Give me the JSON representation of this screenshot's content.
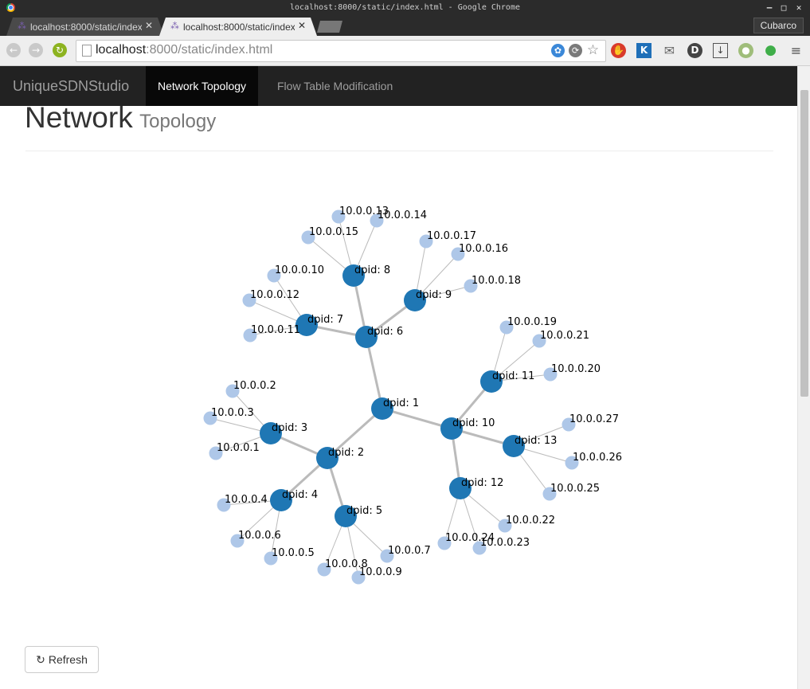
{
  "window": {
    "title": "localhost:8000/static/index.html - Google Chrome"
  },
  "tabs": [
    {
      "label": "localhost:8000/static/index.html",
      "active": false
    },
    {
      "label": "localhost:8000/static/index.html",
      "active": true
    }
  ],
  "profile_name": "Cubarco",
  "address": {
    "host": "localhost",
    "rest": ":8000/static/index.html"
  },
  "app": {
    "brand": "UniqueSDNStudio",
    "nav": [
      {
        "label": "Network Topology",
        "active": true
      },
      {
        "label": "Flow Table Modification",
        "active": false
      }
    ]
  },
  "page": {
    "title": "Network",
    "subtitle": "Topology"
  },
  "topology": {
    "switch_color": "#1f77b4",
    "host_color": "#aec7e8",
    "switches": [
      {
        "id": "s1",
        "label": "dpid: 1"
      },
      {
        "id": "s2",
        "label": "dpid: 2"
      },
      {
        "id": "s3",
        "label": "dpid: 3"
      },
      {
        "id": "s4",
        "label": "dpid: 4"
      },
      {
        "id": "s5",
        "label": "dpid: 5"
      },
      {
        "id": "s6",
        "label": "dpid: 6"
      },
      {
        "id": "s7",
        "label": "dpid: 7"
      },
      {
        "id": "s8",
        "label": "dpid: 8"
      },
      {
        "id": "s9",
        "label": "dpid: 9"
      },
      {
        "id": "s10",
        "label": "dpid: 10"
      },
      {
        "id": "s11",
        "label": "dpid: 11"
      },
      {
        "id": "s12",
        "label": "dpid: 12"
      },
      {
        "id": "s13",
        "label": "dpid: 13"
      }
    ],
    "hosts": [
      {
        "id": "h1",
        "label": "10.0.0.1",
        "switch": "s3"
      },
      {
        "id": "h2",
        "label": "10.0.0.2",
        "switch": "s3"
      },
      {
        "id": "h3",
        "label": "10.0.0.3",
        "switch": "s3"
      },
      {
        "id": "h4",
        "label": "10.0.0.4",
        "switch": "s4"
      },
      {
        "id": "h5",
        "label": "10.0.0.5",
        "switch": "s4"
      },
      {
        "id": "h6",
        "label": "10.0.0.6",
        "switch": "s4"
      },
      {
        "id": "h7",
        "label": "10.0.0.7",
        "switch": "s5"
      },
      {
        "id": "h8",
        "label": "10.0.0.8",
        "switch": "s5"
      },
      {
        "id": "h9",
        "label": "10.0.0.9",
        "switch": "s5"
      },
      {
        "id": "h10",
        "label": "10.0.0.10",
        "switch": "s7"
      },
      {
        "id": "h11",
        "label": "10.0.0.11",
        "switch": "s7"
      },
      {
        "id": "h12",
        "label": "10.0.0.12",
        "switch": "s7"
      },
      {
        "id": "h13",
        "label": "10.0.0.13",
        "switch": "s8"
      },
      {
        "id": "h14",
        "label": "10.0.0.14",
        "switch": "s8"
      },
      {
        "id": "h15",
        "label": "10.0.0.15",
        "switch": "s8"
      },
      {
        "id": "h16",
        "label": "10.0.0.16",
        "switch": "s9"
      },
      {
        "id": "h17",
        "label": "10.0.0.17",
        "switch": "s9"
      },
      {
        "id": "h18",
        "label": "10.0.0.18",
        "switch": "s9"
      },
      {
        "id": "h19",
        "label": "10.0.0.19",
        "switch": "s11"
      },
      {
        "id": "h20",
        "label": "10.0.0.20",
        "switch": "s11"
      },
      {
        "id": "h21",
        "label": "10.0.0.21",
        "switch": "s11"
      },
      {
        "id": "h22",
        "label": "10.0.0.22",
        "switch": "s12"
      },
      {
        "id": "h23",
        "label": "10.0.0.23",
        "switch": "s12"
      },
      {
        "id": "h24",
        "label": "10.0.0.24",
        "switch": "s12"
      },
      {
        "id": "h25",
        "label": "10.0.0.25",
        "switch": "s13"
      },
      {
        "id": "h26",
        "label": "10.0.0.26",
        "switch": "s13"
      },
      {
        "id": "h27",
        "label": "10.0.0.27",
        "switch": "s13"
      }
    ],
    "switch_links": [
      [
        "s1",
        "s2"
      ],
      [
        "s1",
        "s6"
      ],
      [
        "s1",
        "s10"
      ],
      [
        "s2",
        "s3"
      ],
      [
        "s2",
        "s4"
      ],
      [
        "s2",
        "s5"
      ],
      [
        "s6",
        "s7"
      ],
      [
        "s6",
        "s8"
      ],
      [
        "s6",
        "s9"
      ],
      [
        "s10",
        "s11"
      ],
      [
        "s10",
        "s12"
      ],
      [
        "s10",
        "s13"
      ]
    ]
  },
  "refresh_label": "Refresh"
}
